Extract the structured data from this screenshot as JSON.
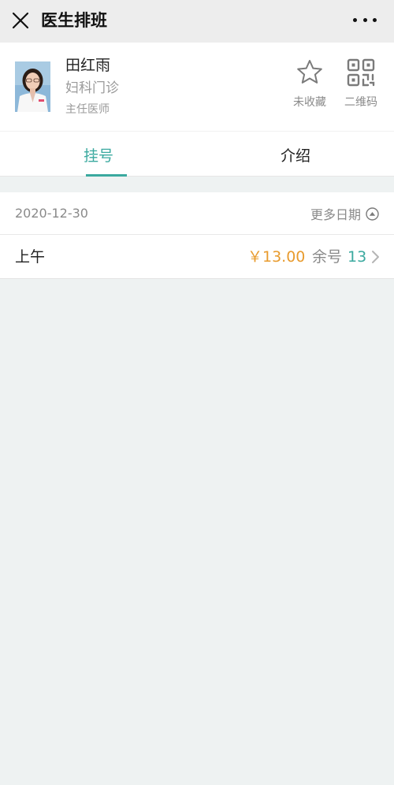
{
  "navbar": {
    "title": "医生排班",
    "close_icon": "close-icon",
    "more_icon": "more-icon"
  },
  "doctor": {
    "name": "田红雨",
    "department": "妇科门诊",
    "title": "主任医师"
  },
  "actions": {
    "favorite_label": "未收藏",
    "qrcode_label": "二维码"
  },
  "tabs": [
    {
      "label": "挂号",
      "active": true
    },
    {
      "label": "介绍",
      "active": false
    }
  ],
  "schedule": {
    "date": "2020-12-30",
    "more_dates_label": "更多日期",
    "slots": [
      {
        "period": "上午",
        "price": "￥13.00",
        "remain_label": "余号",
        "remain_count": "13"
      }
    ]
  },
  "colors": {
    "accent": "#3aa99f",
    "price": "#e89b2e",
    "background": "#eef2f2"
  }
}
